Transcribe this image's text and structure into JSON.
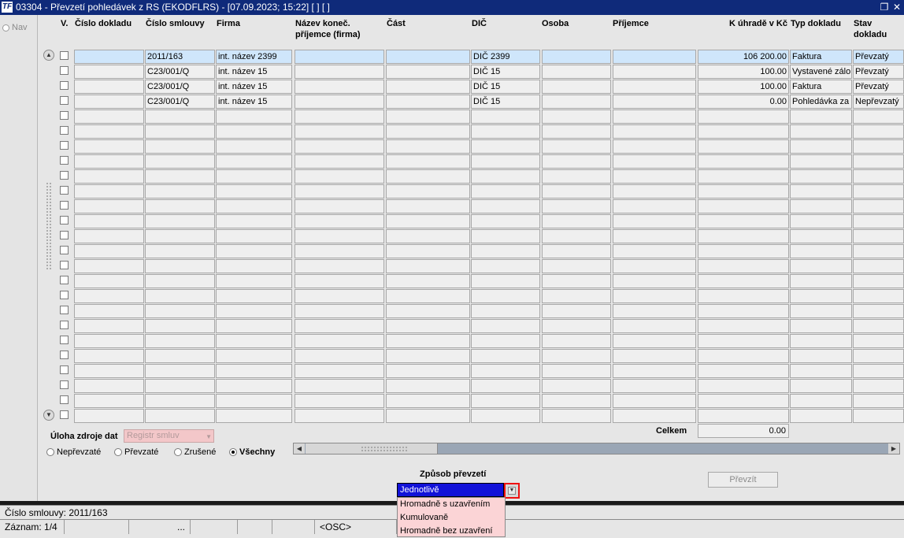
{
  "window": {
    "title": "03304 - Převzetí pohledávek z RS (EKODFLRS) - [07.09.2023; 15:22]  [ ]  [ ]",
    "app_icon": "TF",
    "restore_icon": "restore-icon",
    "close_icon": "close-icon"
  },
  "nav": {
    "label": "Nav"
  },
  "columns": [
    {
      "label": "V."
    },
    {
      "label": "Číslo dokladu"
    },
    {
      "label": "Číslo smlouvy"
    },
    {
      "label": "Firma"
    },
    {
      "label": "Název koneč. příjemce (firma)"
    },
    {
      "label": "Část"
    },
    {
      "label": "DIČ"
    },
    {
      "label": "Osoba"
    },
    {
      "label": "Příjemce"
    },
    {
      "label": "K úhradě v Kč"
    },
    {
      "label": "Typ dokladu"
    },
    {
      "label": "Stav dokladu"
    }
  ],
  "rows": [
    {
      "cislo_dokladu": "",
      "cislo_smlouvy": "2011/163",
      "firma": "int. název 2399",
      "nazev": "",
      "cast": "",
      "dic": "DIČ 2399",
      "osoba": "",
      "prijemce": "",
      "k_uhrade": "106 200.00",
      "typ": "Faktura",
      "stav": "Převzatý"
    },
    {
      "cislo_dokladu": "",
      "cislo_smlouvy": "C23/001/Q",
      "firma": "int. název 15",
      "nazev": "",
      "cast": "",
      "dic": "DIČ 15",
      "osoba": "",
      "prijemce": "",
      "k_uhrade": "100.00",
      "typ": "Vystavené zálo",
      "stav": "Převzatý"
    },
    {
      "cislo_dokladu": "",
      "cislo_smlouvy": "C23/001/Q",
      "firma": "int. název 15",
      "nazev": "",
      "cast": "",
      "dic": "DIČ 15",
      "osoba": "",
      "prijemce": "",
      "k_uhrade": "100.00",
      "typ": "Faktura",
      "stav": "Převzatý"
    },
    {
      "cislo_dokladu": "",
      "cislo_smlouvy": "C23/001/Q",
      "firma": "int. název 15",
      "nazev": "",
      "cast": "",
      "dic": "DIČ 15",
      "osoba": "",
      "prijemce": "",
      "k_uhrade": "0.00",
      "typ": "Pohledávka za z",
      "stav": "Nepřevzatý"
    }
  ],
  "source": {
    "label": "Úloha zdroje dat",
    "combo_value": "Registr smluv"
  },
  "filters": [
    {
      "label": "Nepřevzaté",
      "checked": false
    },
    {
      "label": "Převzaté",
      "checked": false
    },
    {
      "label": "Zrušené",
      "checked": false
    },
    {
      "label": "Všechny",
      "checked": true
    }
  ],
  "total": {
    "label": "Celkem",
    "value": "0.00"
  },
  "mode": {
    "label": "Způsob převzetí",
    "selected": "Jednotlivě",
    "options": [
      "Hromadně s uzavřením",
      "Kumulovaně",
      "Hromadně bez uzavření"
    ]
  },
  "actions": {
    "prevzit": "Převzít"
  },
  "status": {
    "line1": "Číslo smlouvy: 2011/163",
    "record": "Záznam: 1/4",
    "dots": "...",
    "osc": "<OSC>"
  }
}
